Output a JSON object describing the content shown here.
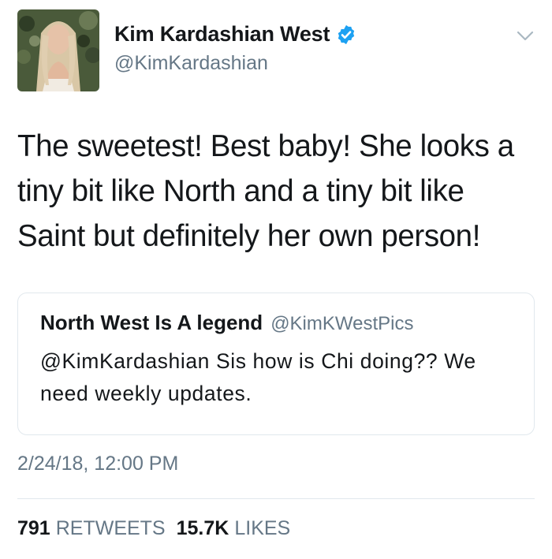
{
  "author": {
    "display_name": "Kim Kardashian West",
    "handle": "@KimKardashian",
    "verified_icon": "verified-badge-icon",
    "avatar": "profile-photo"
  },
  "menu": {
    "icon": "chevron-down-icon"
  },
  "tweet": {
    "text": "The sweetest! Best baby! She looks a tiny bit like North and a tiny bit like Saint but definitely her own person!"
  },
  "quoted_tweet": {
    "display_name": "North West Is A legend",
    "handle": "@KimKWestPics",
    "text": "@KimKardashian Sis how is Chi doing?? We need weekly updates."
  },
  "timestamp": "2/24/18, 12:00 PM",
  "stats": {
    "retweets_count": "791",
    "retweets_label": "RETWEETS",
    "likes_count": "15.7K",
    "likes_label": "LIKES"
  },
  "colors": {
    "text_primary": "#14171a",
    "text_secondary": "#657786",
    "verified_blue": "#1da1f2",
    "border": "#e1e8ed"
  }
}
